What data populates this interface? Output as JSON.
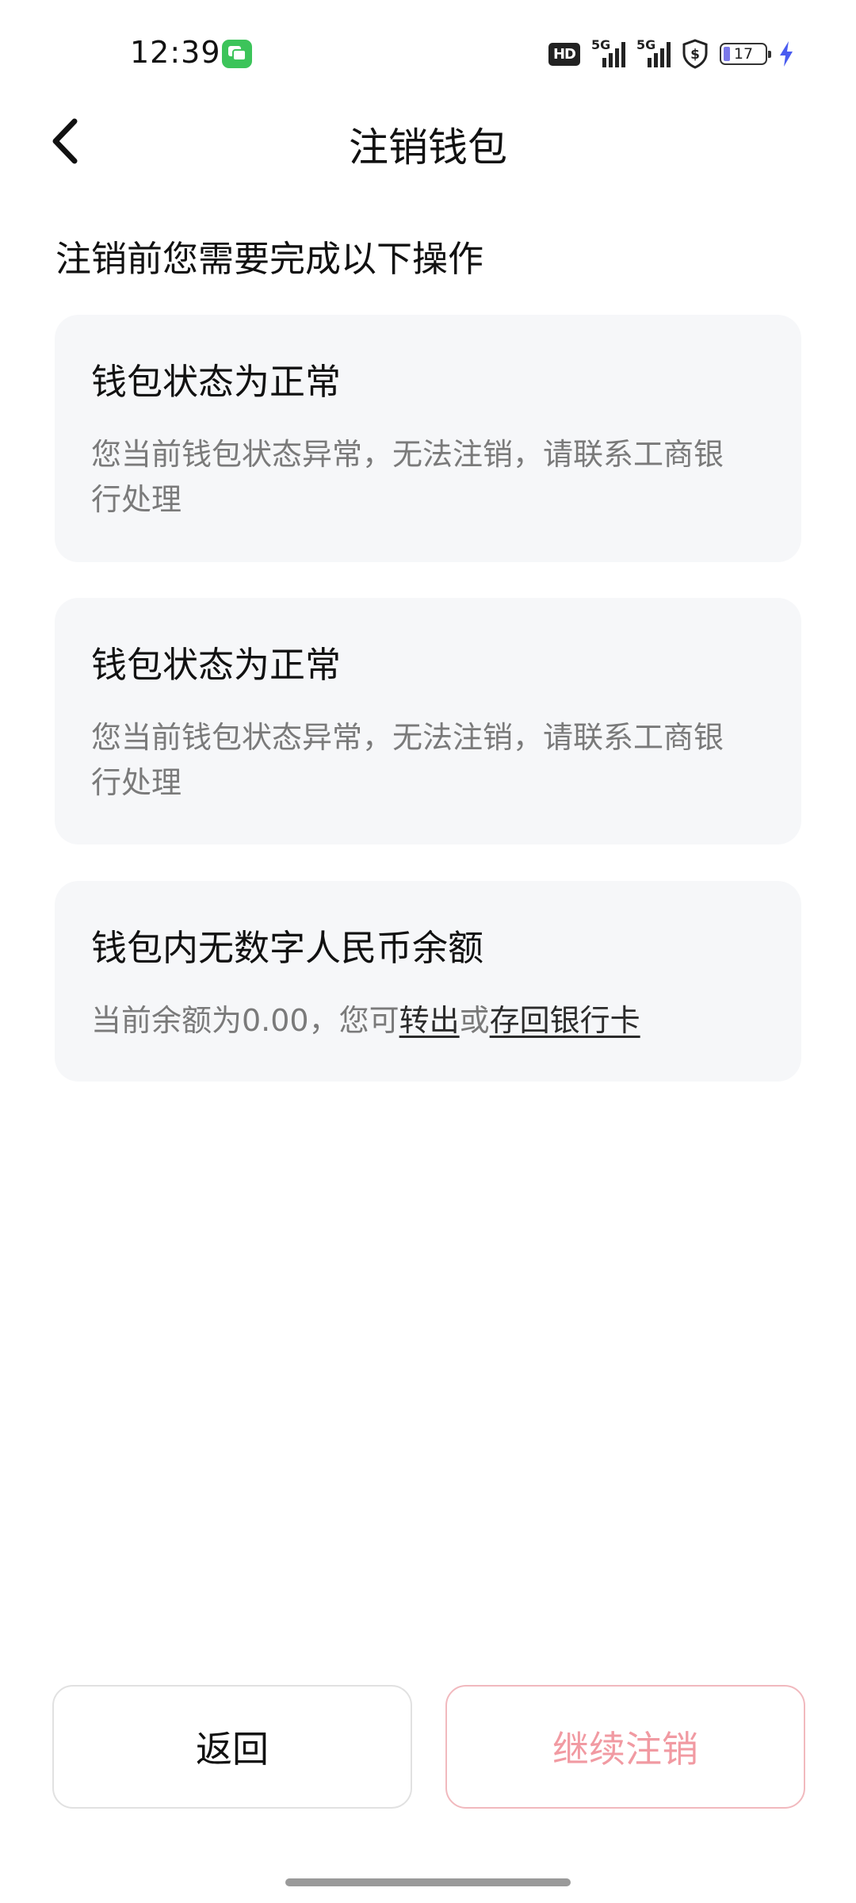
{
  "status_bar": {
    "time": "12:39",
    "hd_label": "HD",
    "signal_1_label": "5G",
    "signal_2_label": "5G",
    "battery_level": "17",
    "message_icon": "message-app-icon",
    "battery_fill_color": "#7a78e8",
    "charging_color": "#4a5cf0"
  },
  "header": {
    "title": "注销钱包",
    "back_icon": "chevron-left-icon"
  },
  "subtitle": "注销前您需要完成以下操作",
  "cards": [
    {
      "title": "钱包状态为正常",
      "desc_line1": "您当前钱包状态异常，无法注销，请联系工商银",
      "desc_line2": "行处理"
    },
    {
      "title": "钱包状态为正常",
      "desc_line1": "您当前钱包状态异常，无法注销，请联系工商银",
      "desc_line2": "行处理"
    },
    {
      "title": "钱包内无数字人民币余额",
      "desc_prefix": "当前余额为0.00，您可",
      "link_transfer": "转出",
      "desc_or": "或",
      "link_deposit": "存回银行卡"
    }
  ],
  "buttons": {
    "back_label": "返回",
    "continue_label": "继续注销",
    "continue_color": "#f19aa2"
  }
}
